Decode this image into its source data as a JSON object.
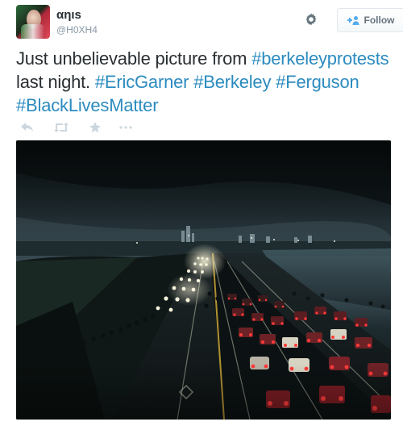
{
  "user": {
    "display_name": "αηιs",
    "screen_name": "@H0XH4"
  },
  "follow_button": {
    "label": "Follow"
  },
  "tweet": {
    "text_segments": [
      {
        "text": "Just unbelievable picture from ",
        "hashtag": false
      },
      {
        "text": "#berkeleyprotests",
        "hashtag": true
      },
      {
        "text": " last night. ",
        "hashtag": false
      },
      {
        "text": "#EricGarner",
        "hashtag": true
      },
      {
        "text": " ",
        "hashtag": false
      },
      {
        "text": "#Berkeley",
        "hashtag": true
      },
      {
        "text": " ",
        "hashtag": false
      },
      {
        "text": "#Ferguson",
        "hashtag": true
      },
      {
        "text": " ",
        "hashtag": false
      },
      {
        "text": "#BlackLivesMatter",
        "hashtag": true
      }
    ]
  },
  "actions": [
    "reply-icon",
    "retweet-icon",
    "favorite-icon",
    "more-icon"
  ],
  "colors": {
    "hashtag": "#2b8bbf",
    "text": "#292f33",
    "muted": "#8899a6",
    "action_icon": "#ccd6dd"
  }
}
